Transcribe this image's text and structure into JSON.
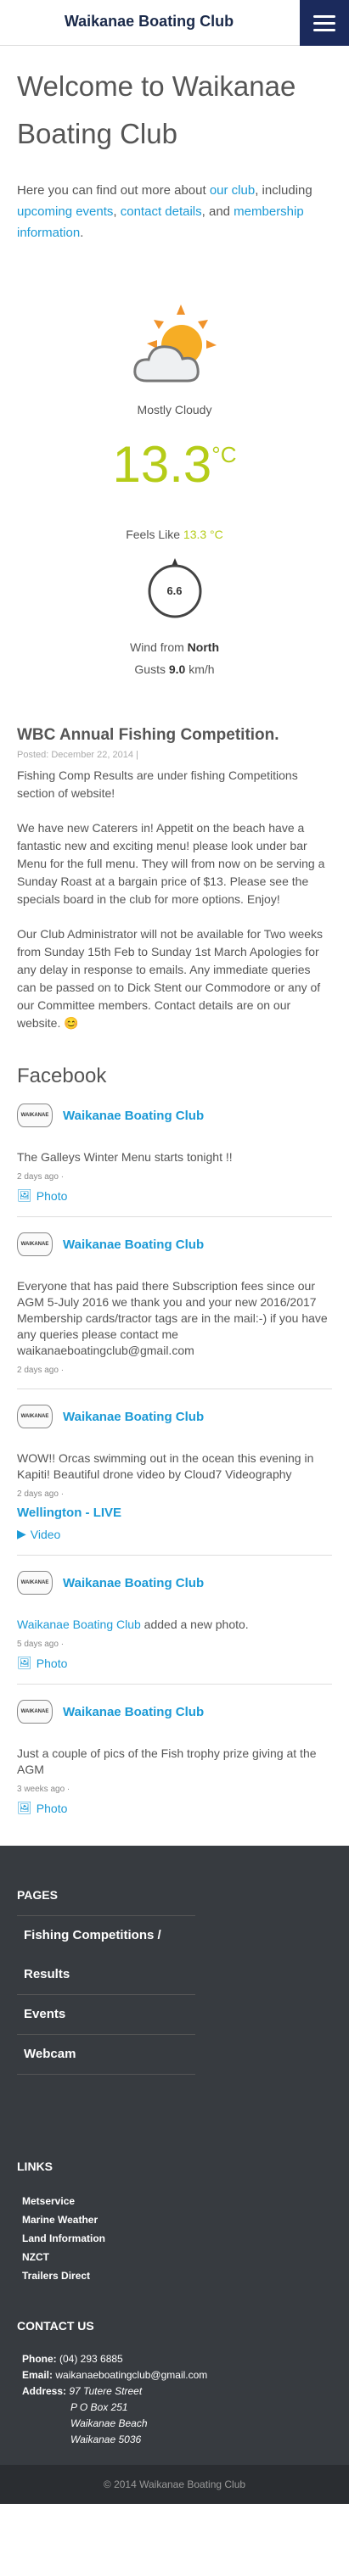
{
  "header": {
    "title": "Waikanae Boating Club",
    "menu_icon": "hamburger-icon"
  },
  "page": {
    "title": "Welcome to Waikanae Boating Club",
    "intro": {
      "t1": "Here you can find out more about ",
      "l1": "our club",
      "t2": ", including ",
      "l2": "upcoming events",
      "t3": ", ",
      "l3": "contact details",
      "t4": ", and ",
      "l4": "membership information",
      "t5": "."
    }
  },
  "weather": {
    "icon": "partly-cloudy-icon",
    "condition": "Mostly Cloudy",
    "temp": "13.3",
    "unit": "°C",
    "feels_label": "Feels Like ",
    "feels_value": "13.3 °C",
    "wind_speed": "6.6",
    "wind_from_label": "Wind from ",
    "wind_from": "North",
    "gusts_label": "Gusts ",
    "gusts_value": "9.0",
    "gusts_unit": " km/h",
    "colors": {
      "accent": "#b5cc18"
    }
  },
  "post": {
    "title": "WBC Annual Fishing Competition.",
    "meta": "Posted: December 22, 2014 |",
    "p1": "Fishing Comp Results are under fishing Competitions section of website!",
    "p2": "We have new Caterers in! Appetit on the beach have a fantastic new and exciting menu! please look under bar Menu for the full menu. They will from now on be serving a Sunday Roast at a bargain price of $13. Please see the specials board in the club for more options. Enjoy!",
    "p3": "Our Club Administrator will not be available for Two weeks from Sunday 15th Feb to Sunday 1st March Apologies for any delay in response to emails. Any immediate queries can be passed on to Dick Stent our Commodore or any of our Committee members. Contact details are on our website. 😊"
  },
  "facebook": {
    "heading": "Facebook",
    "logo_text": "WAIKANAE",
    "items": [
      {
        "name": "Waikanae Boating Club",
        "text": "The Galleys Winter Menu starts tonight !!",
        "time": "2 days ago ·",
        "link": "Photo",
        "link_icon": "photo-icon"
      },
      {
        "name": "Waikanae Boating Club",
        "text": "Everyone that has paid there Subscription fees since our AGM 5-July 2016 we thank you and your new 2016/2017 Membership cards/tractor tags are in the mail:-) if you have any queries please contact me waikanaeboatingclub@gmail.com",
        "time": "2 days ago ·",
        "link": "",
        "link_icon": ""
      },
      {
        "name": "Waikanae Boating Club",
        "text": "WOW!! Orcas swimming out in the ocean this evening in Kapiti! Beautiful drone video by Cloud7 Videography",
        "time": "2 days ago ·",
        "strong": "Wellington - LIVE",
        "link": "Video",
        "link_icon": "video-icon"
      },
      {
        "name": "Waikanae Boating Club",
        "text_link": "Waikanae Boating Club",
        "text": " added a new photo.",
        "time": "5 days ago ·",
        "link": "Photo",
        "link_icon": "photo-icon"
      },
      {
        "name": "Waikanae Boating Club",
        "text": "Just a couple of pics of the Fish trophy prize giving at the AGM",
        "time": "3 weeks ago ·",
        "link": "Photo",
        "link_icon": "photo-icon"
      }
    ]
  },
  "footer": {
    "pages_heading": "PAGES",
    "pages": [
      "Fishing Competitions / Results",
      "Events",
      "Webcam"
    ],
    "links_heading": "LINKS",
    "links": [
      "Metservice",
      "Marine Weather",
      "Land Information",
      "NZCT",
      "Trailers Direct"
    ],
    "contact_heading": "CONTACT US",
    "phone_label": "Phone:",
    "phone": " (04) 293 6885",
    "email_label": "Email:",
    "email": " waikanaeboatingclub@gmail.com",
    "address_label": "Address:",
    "address": [
      "97 Tutere Street",
      "P O Box 251",
      "Waikanae Beach",
      "Waikanae 5036"
    ],
    "copyright": "© 2014 Waikanae Boating Club"
  }
}
